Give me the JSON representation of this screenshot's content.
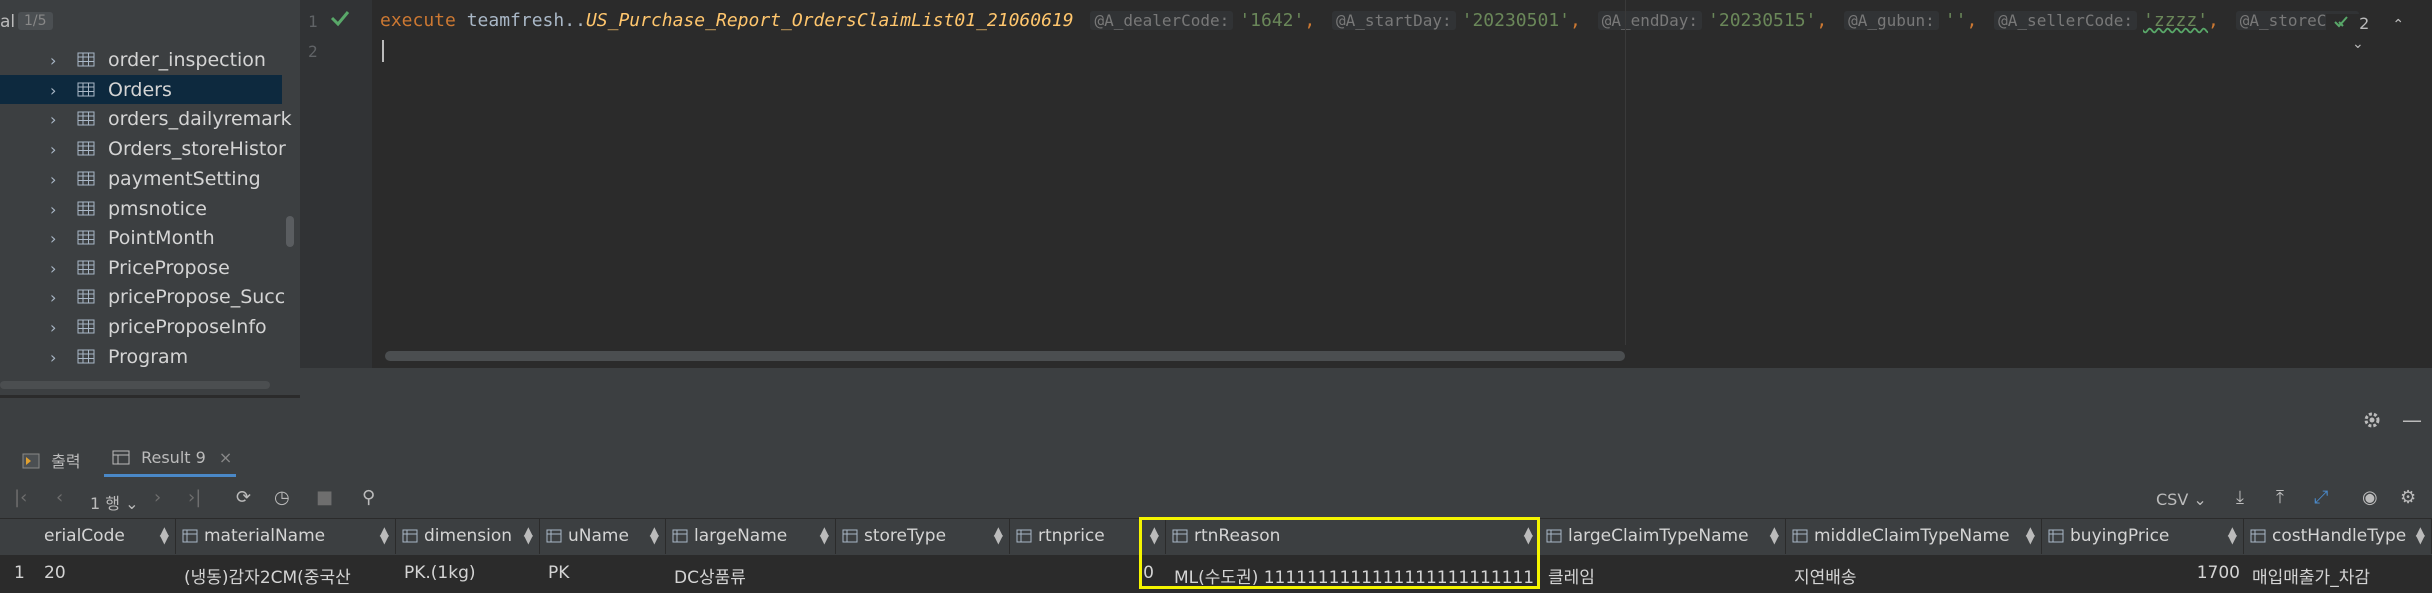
{
  "tree": {
    "left_label": "al",
    "counter": "1/5",
    "items": [
      {
        "label": "order_inspection"
      },
      {
        "label": "Orders"
      },
      {
        "label": "orders_dailyremark"
      },
      {
        "label": "Orders_storeHistor"
      },
      {
        "label": "paymentSetting"
      },
      {
        "label": "pmsnotice"
      },
      {
        "label": "PointMonth"
      },
      {
        "label": "PricePropose"
      },
      {
        "label": "pricePropose_Succ"
      },
      {
        "label": "priceProposeInfo"
      },
      {
        "label": "Program"
      }
    ]
  },
  "editor": {
    "line_numbers": [
      "1",
      "2"
    ],
    "code": {
      "execute": "execute",
      "schema": "teamfresh",
      "dots": "..",
      "proc": "US_Purchase_Report_OrdersClaimList01_21060619",
      "params": [
        {
          "hint": "@A_dealerCode:",
          "value": "'1642'"
        },
        {
          "hint": "@A_startDay:",
          "value": "'20230501'"
        },
        {
          "hint": "@A_endDay:",
          "value": "'20230515'"
        },
        {
          "hint": "@A_gubun:",
          "value": "''"
        },
        {
          "hint": "@A_sellerCode:",
          "value": "'zzzz'"
        },
        {
          "hint": "@A_storeCode",
          "value": ""
        }
      ],
      "comma": ","
    },
    "status_count": "2"
  },
  "tool_window": {
    "tabs": [
      {
        "label": "출력"
      },
      {
        "label": "Result 9"
      }
    ],
    "row_selector": "1 행",
    "export_format": "CSV"
  },
  "grid": {
    "row_number": "1",
    "columns": [
      {
        "name": "erialCode",
        "value": "20"
      },
      {
        "name": "materialName",
        "value": "(냉동)감자2CM(중국산"
      },
      {
        "name": "dimension",
        "value": "PK.(1kg)"
      },
      {
        "name": "uName",
        "value": "PK"
      },
      {
        "name": "largeName",
        "value": "DC상품류"
      },
      {
        "name": "storeType",
        "value": ""
      },
      {
        "name": "rtnprice",
        "value": "0"
      },
      {
        "name": "rtnReason",
        "value": "ML(수도권) 1111111111111111111111111"
      },
      {
        "name": "largeClaimTypeName",
        "value": "클레임"
      },
      {
        "name": "middleClaimTypeName",
        "value": "지연배송"
      },
      {
        "name": "buyingPrice",
        "value": "1700"
      },
      {
        "name": "costHandleType",
        "value": "매입매출가_차감"
      }
    ]
  },
  "colors": {
    "highlight": "#f5f500",
    "selection": "#0d293e",
    "accent": "#4a88c7",
    "check": "#59a869"
  }
}
